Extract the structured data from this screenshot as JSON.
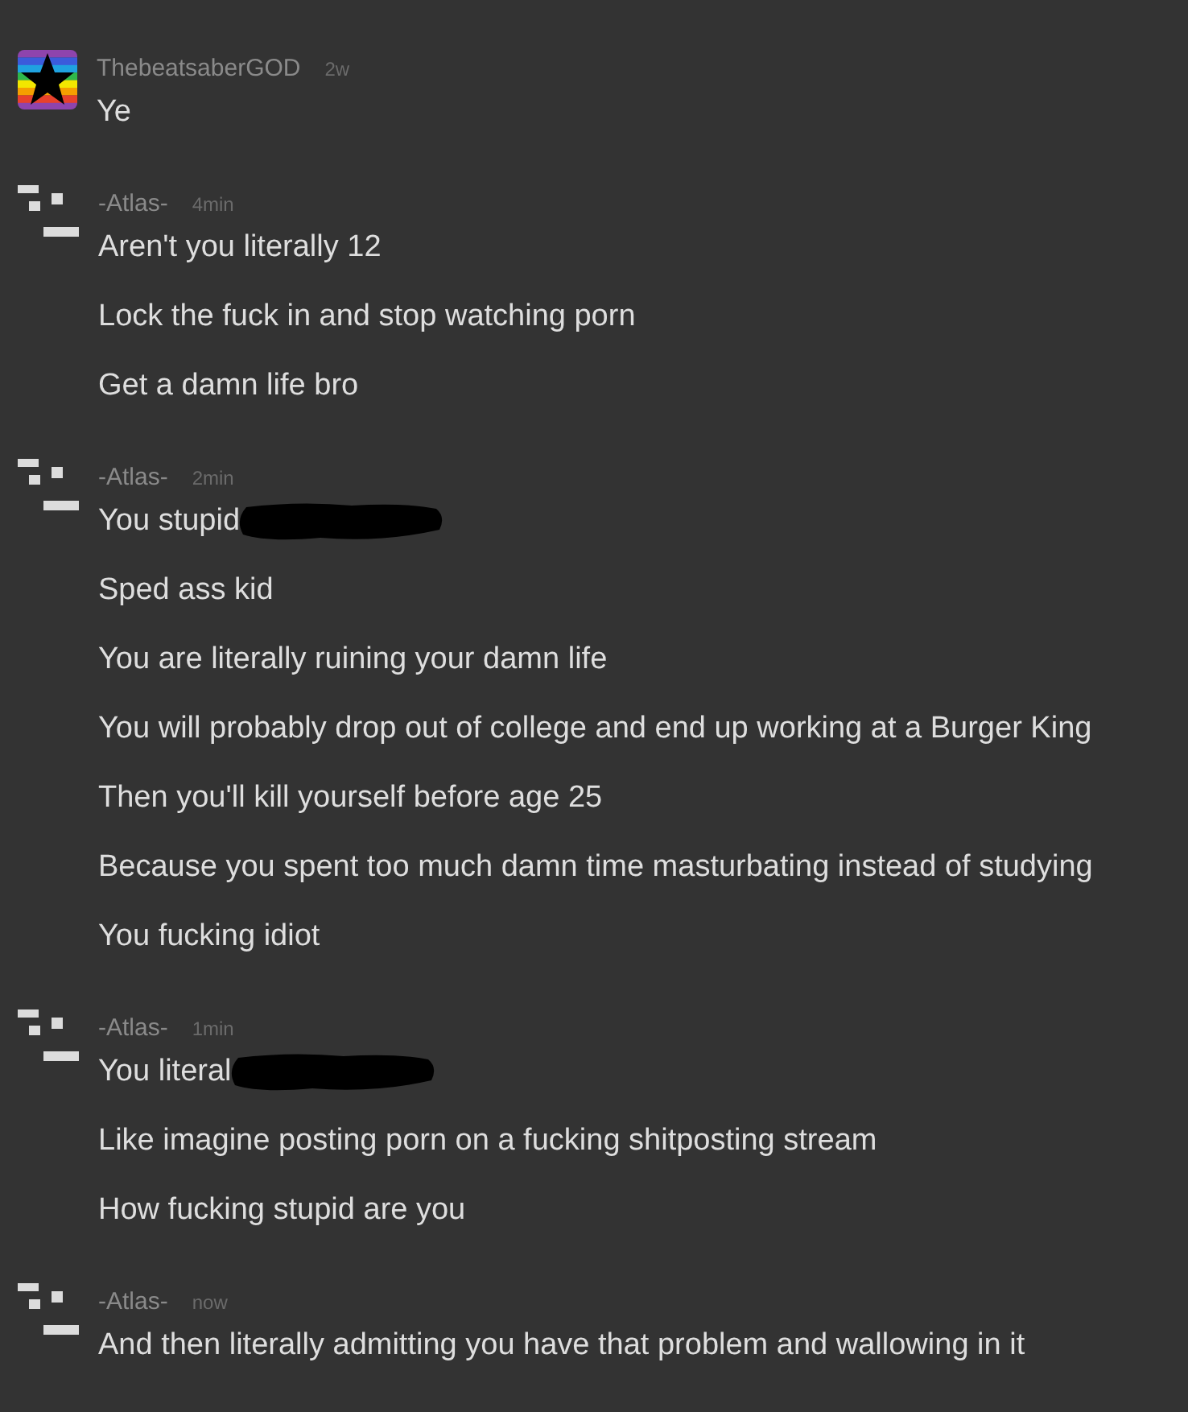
{
  "messages": [
    {
      "author": "ThebeatsaberGOD",
      "time": "2w",
      "avatar": {
        "kind": "rainbow-star"
      },
      "lines": [
        {
          "text": "Ye"
        }
      ]
    },
    {
      "author": "-Atlas-",
      "time": "4min",
      "avatar": {
        "kind": "blocks"
      },
      "lines": [
        {
          "text": "Aren't you literally 12"
        },
        {
          "text": "Lock the fuck in and stop watching porn"
        },
        {
          "text": "Get a damn life bro"
        }
      ]
    },
    {
      "author": "-Atlas-",
      "time": "2min",
      "avatar": {
        "kind": "blocks"
      },
      "lines": [
        {
          "text": "You stupid",
          "redacted": true
        },
        {
          "text": "Sped ass kid"
        },
        {
          "text": "You are literally ruining your damn life"
        },
        {
          "text": "You will probably drop out of college and end up working at a Burger King"
        },
        {
          "text": "Then you'll kill yourself before age 25"
        },
        {
          "text": "Because you spent too much damn time masturbating instead of studying"
        },
        {
          "text": "You fucking idiot"
        }
      ]
    },
    {
      "author": "-Atlas-",
      "time": "1min",
      "avatar": {
        "kind": "blocks"
      },
      "lines": [
        {
          "text": "You literal",
          "redacted": true
        },
        {
          "text": "Like imagine posting porn on a fucking shitposting stream"
        },
        {
          "text": "How fucking stupid are you"
        }
      ]
    },
    {
      "author": "-Atlas-",
      "time": "now",
      "avatar": {
        "kind": "blocks"
      },
      "lines": [
        {
          "text": "And then literally admitting you have that problem and wallowing in it"
        }
      ]
    }
  ]
}
